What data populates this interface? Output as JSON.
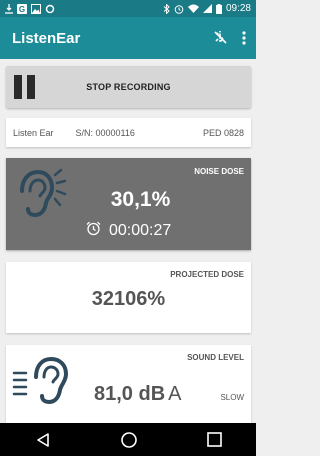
{
  "status_bar": {
    "time": "09:28",
    "left_icons": [
      "notification-icon",
      "google-icon",
      "image-icon",
      "ring-icon"
    ],
    "right_icons": [
      "bluetooth-icon",
      "alarm-icon",
      "wifi-icon",
      "signal-icon",
      "battery-icon"
    ]
  },
  "app_bar": {
    "title": "ListenEar",
    "action_icons": [
      "bluetooth-disabled-icon",
      "more-vert-icon"
    ]
  },
  "record_button": {
    "label": "STOP RECORDING",
    "icon": "pause-icon"
  },
  "device": {
    "name": "Listen Ear",
    "serial": "S/N: 00000116",
    "ped": "PED 0828"
  },
  "noise_dose": {
    "label": "NOISE DOSE",
    "value": "30,1%",
    "timer": "00:00:27",
    "icon": "ear-icon",
    "timer_icon": "alarm-clock-icon"
  },
  "projected_dose": {
    "label": "PROJECTED DOSE",
    "value": "32106%"
  },
  "sound_level": {
    "label": "SOUND LEVEL",
    "value": "81,0 dB",
    "weighting": "A",
    "mode": "SLOW",
    "icon": "ear-sound-icon"
  },
  "nav_bar": {
    "icons": [
      "back-icon",
      "home-icon",
      "recents-icon"
    ]
  },
  "colors": {
    "status_bar": "#1a7a85",
    "app_bar": "#1d8c99",
    "noise_card": "#707070",
    "ear_icon": "#2e4a5c"
  }
}
